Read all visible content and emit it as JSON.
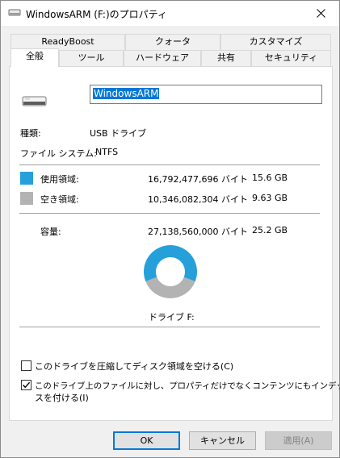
{
  "window": {
    "title": "WindowsARM (F:)のプロパティ"
  },
  "tabs_top": [
    "ReadyBoost",
    "クォータ",
    "カスタマイズ"
  ],
  "tabs_bottom": [
    "全般",
    "ツール",
    "ハードウェア",
    "共有",
    "セキュリティ"
  ],
  "general": {
    "volume_name": "WindowsARM",
    "type_label": "種類:",
    "type_value": "USB ドライブ",
    "fs_label": "ファイル システム:",
    "fs_value": "NTFS",
    "used_label": "使用領域:",
    "used_bytes": "16,792,477,696 バイト",
    "used_gb": "15.6 GB",
    "free_label": "空き領域:",
    "free_bytes": "10,346,082,304 バイト",
    "free_gb": "9.63 GB",
    "capacity_label": "容量:",
    "capacity_bytes": "27,138,560,000 バイト",
    "capacity_gb": "25.2 GB",
    "drive_label": "ドライブ F:",
    "used_fraction": 0.619,
    "used_color": "#26a0da",
    "free_color": "#b3b3b3"
  },
  "options": {
    "compress_label": "このドライブを圧縮してディスク領域を空ける(C)",
    "compress_checked": false,
    "index_label_line1": "このドライブ上のファイルに対し、プロパティだけでなくコンテンツにもインデック",
    "index_label_line2": "スを付ける(I)",
    "index_checked": true
  },
  "buttons": {
    "ok": "OK",
    "cancel": "キャンセル",
    "apply": "適用(A)"
  }
}
